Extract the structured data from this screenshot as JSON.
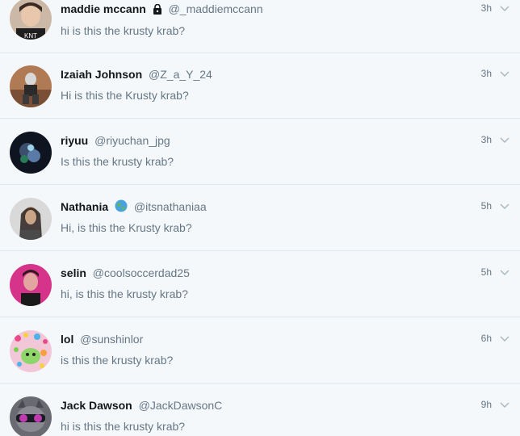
{
  "tweets": [
    {
      "name": "maddie mccann",
      "handle": "@_maddiemccann",
      "badge": "lock-icon",
      "time": "3h",
      "text": "hi is this the krusty krab?"
    },
    {
      "name": "Izaiah Johnson",
      "handle": "@Z_a_Y_24",
      "badge": "",
      "time": "3h",
      "text": "Hi is this the Krusty krab?"
    },
    {
      "name": "riyuu",
      "handle": "@riyuchan_jpg",
      "badge": "",
      "time": "3h",
      "text": "Is this the krusty krab?"
    },
    {
      "name": "Nathania",
      "handle": "@itsnathaniaa",
      "badge": "globe-emoji-icon",
      "time": "5h",
      "text": "Hi, is this the Krusty krab?"
    },
    {
      "name": "selin",
      "handle": "@coolsoccerdad25",
      "badge": "",
      "time": "5h",
      "text": "hi, is this the krusty krab?"
    },
    {
      "name": "lol",
      "handle": "@sunshinlor",
      "badge": "",
      "time": "6h",
      "text": "is this the krusty krab?"
    },
    {
      "name": "Jack Dawson",
      "handle": "@JackDawsonC",
      "badge": "",
      "time": "9h",
      "text": "hi is this the krusty krab?"
    }
  ],
  "colors": {
    "background": "#f5f8fa",
    "divider": "#e1e8ed",
    "name": "#14171a",
    "secondary": "#657786"
  }
}
